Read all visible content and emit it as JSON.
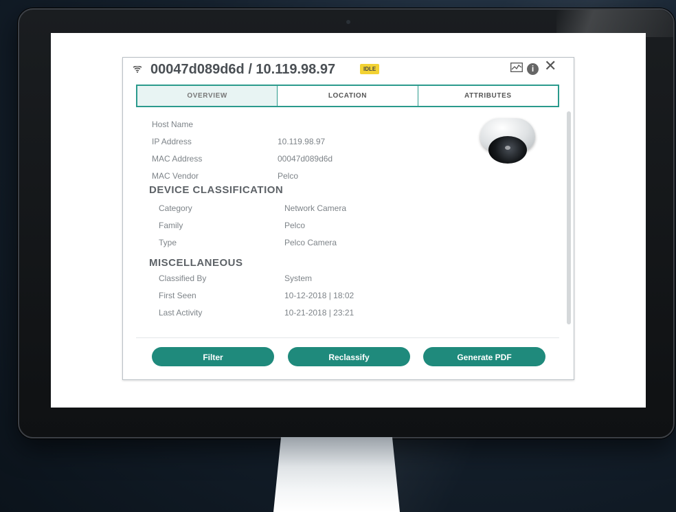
{
  "device": {
    "title": "00047d089d6d / 10.119.98.97",
    "status_badge": "IDLE",
    "header_icon": "wifi-signal-icon"
  },
  "controls": {
    "chart_icon": "activity-chart-icon",
    "info_icon": "info-icon",
    "close_icon": "close-icon"
  },
  "tabs": [
    {
      "label": "OVERVIEW",
      "active": true
    },
    {
      "label": "LOCATION",
      "active": false
    },
    {
      "label": "ATTRIBUTES",
      "active": false
    }
  ],
  "overview": {
    "fields": [
      {
        "label": "Host Name",
        "value": ""
      },
      {
        "label": "IP Address",
        "value": "10.119.98.97"
      },
      {
        "label": "MAC Address",
        "value": "00047d089d6d"
      },
      {
        "label": "MAC Vendor",
        "value": "Pelco"
      }
    ]
  },
  "device_classification": {
    "heading": "DEVICE CLASSIFICATION",
    "fields": [
      {
        "label": "Category",
        "value": "Network Camera"
      },
      {
        "label": "Family",
        "value": "Pelco"
      },
      {
        "label": "Type",
        "value": "Pelco Camera"
      }
    ]
  },
  "miscellaneous": {
    "heading": "MISCELLANEOUS",
    "fields": [
      {
        "label": "Classified By",
        "value": "System"
      },
      {
        "label": "First Seen",
        "value": "10-12-2018 | 18:02"
      },
      {
        "label": "Last Activity",
        "value": "10-21-2018 | 23:21"
      }
    ]
  },
  "device_image": "dome-camera-image",
  "actions": {
    "filter": "Filter",
    "reclassify": "Reclassify",
    "generate_pdf": "Generate PDF"
  },
  "colors": {
    "accent": "#1f8a7c",
    "badge": "#f2d233"
  }
}
